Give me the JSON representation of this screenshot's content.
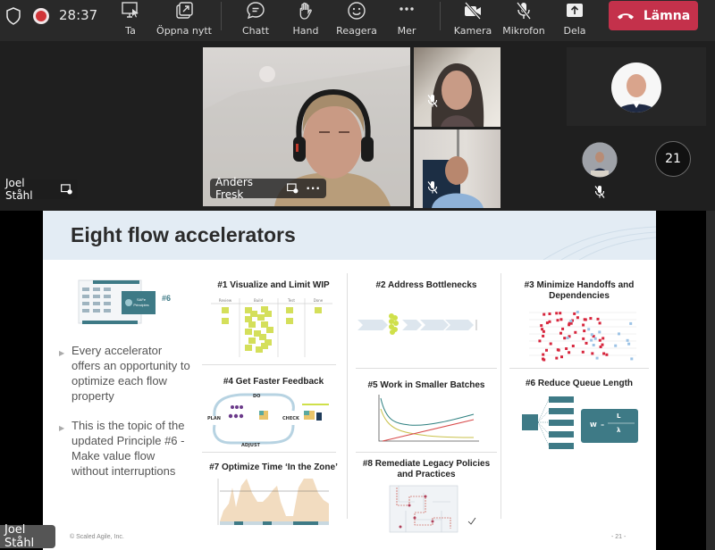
{
  "toolbar": {
    "timer": "28:37",
    "buttons": [
      {
        "label": "Ta",
        "icon": "take-control-icon"
      },
      {
        "label": "Öppna nytt",
        "icon": "pop-out-icon"
      },
      {
        "label": "Chatt",
        "icon": "chat-icon"
      },
      {
        "label": "Hand",
        "icon": "raise-hand-icon"
      },
      {
        "label": "Reagera",
        "icon": "react-icon"
      },
      {
        "label": "Mer",
        "icon": "more-icon"
      },
      {
        "label": "Kamera",
        "icon": "camera-off-icon"
      },
      {
        "label": "Mikrofon",
        "icon": "mic-off-icon"
      },
      {
        "label": "Dela",
        "icon": "share-icon"
      }
    ],
    "leave_label": "Lämna",
    "accent_color": "#c4314b"
  },
  "participants": {
    "presenter_name": "Joel Ståhl",
    "main_speaker": "Anders Fresk",
    "overflow_count": "21",
    "bottom_speaker_label": "Joel Ståhl"
  },
  "slide": {
    "title": "Eight flow accelerators",
    "principle_badge": "#6",
    "principle_card_label": "SAFe Principles",
    "bullets": [
      "Every accelerator offers an opportunity to optimize each flow property",
      "This is the topic of the updated Principle #6 - Make value flow without interruptions"
    ],
    "accelerators": [
      {
        "title": "#1 Visualize and Limit WIP",
        "columns": [
          "Review",
          "Build",
          "Test",
          "Done"
        ]
      },
      {
        "title": "#2 Address Bottlenecks"
      },
      {
        "title": "#3 Minimize Handoffs and Dependencies"
      },
      {
        "title": "#4 Get Faster Feedback",
        "cycle": [
          "DO",
          "CHECK",
          "ADJUST",
          "PLAN"
        ]
      },
      {
        "title": "#5 Work in Smaller Batches"
      },
      {
        "title": "#6 Reduce Queue Length",
        "formula": [
          "W",
          "=",
          "L",
          "λ"
        ]
      },
      {
        "title": "#7 Optimize Time ‘In the Zone’"
      },
      {
        "title": "#8 Remediate Legacy Policies and Practices"
      }
    ],
    "footer_copyright": "© Scaled Agile, Inc.",
    "page_number": "- 21 -"
  }
}
